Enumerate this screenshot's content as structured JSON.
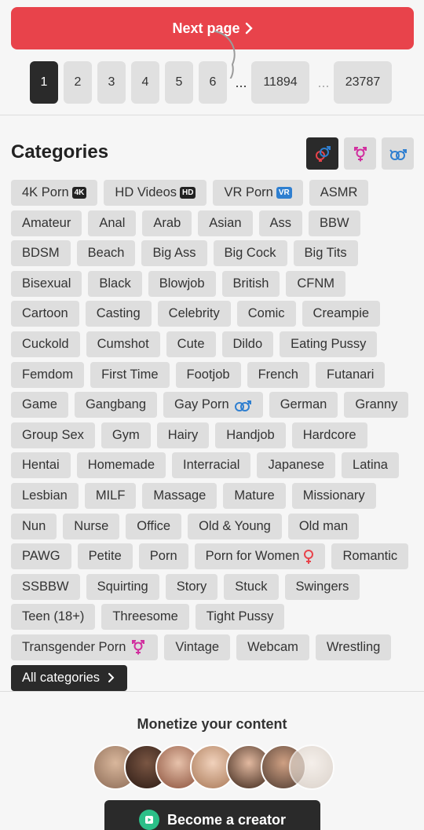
{
  "pager": {
    "next_label": "Next page",
    "pages": [
      "1",
      "2",
      "3",
      "4",
      "5",
      "6"
    ],
    "ellipsis": "...",
    "mid_page": "11894",
    "last_page": "23787",
    "active_page": "1"
  },
  "categories": {
    "title": "Categories",
    "items": [
      {
        "label": "4K Porn",
        "badge": "4K"
      },
      {
        "label": "HD Videos",
        "badge": "HD"
      },
      {
        "label": "VR Porn",
        "badge": "VR"
      },
      {
        "label": "ASMR"
      },
      {
        "label": "Amateur"
      },
      {
        "label": "Anal"
      },
      {
        "label": "Arab"
      },
      {
        "label": "Asian"
      },
      {
        "label": "Ass"
      },
      {
        "label": "BBW"
      },
      {
        "label": "BDSM"
      },
      {
        "label": "Beach"
      },
      {
        "label": "Big Ass"
      },
      {
        "label": "Big Cock"
      },
      {
        "label": "Big Tits"
      },
      {
        "label": "Bisexual"
      },
      {
        "label": "Black"
      },
      {
        "label": "Blowjob"
      },
      {
        "label": "British"
      },
      {
        "label": "CFNM"
      },
      {
        "label": "Cartoon"
      },
      {
        "label": "Casting"
      },
      {
        "label": "Celebrity"
      },
      {
        "label": "Comic"
      },
      {
        "label": "Creampie"
      },
      {
        "label": "Cuckold"
      },
      {
        "label": "Cumshot"
      },
      {
        "label": "Cute"
      },
      {
        "label": "Dildo"
      },
      {
        "label": "Eating Pussy"
      },
      {
        "label": "Femdom"
      },
      {
        "label": "First Time"
      },
      {
        "label": "Footjob"
      },
      {
        "label": "French"
      },
      {
        "label": "Futanari"
      },
      {
        "label": "Game"
      },
      {
        "label": "Gangbang"
      },
      {
        "label": "Gay Porn",
        "icon": "gay-icon"
      },
      {
        "label": "German"
      },
      {
        "label": "Granny"
      },
      {
        "label": "Group Sex"
      },
      {
        "label": "Gym"
      },
      {
        "label": "Hairy"
      },
      {
        "label": "Handjob"
      },
      {
        "label": "Hardcore"
      },
      {
        "label": "Hentai"
      },
      {
        "label": "Homemade"
      },
      {
        "label": "Interracial"
      },
      {
        "label": "Japanese"
      },
      {
        "label": "Latina"
      },
      {
        "label": "Lesbian"
      },
      {
        "label": "MILF"
      },
      {
        "label": "Massage"
      },
      {
        "label": "Mature"
      },
      {
        "label": "Missionary"
      },
      {
        "label": "Nun"
      },
      {
        "label": "Nurse"
      },
      {
        "label": "Office"
      },
      {
        "label": "Old & Young"
      },
      {
        "label": "Old man"
      },
      {
        "label": "PAWG"
      },
      {
        "label": "Petite"
      },
      {
        "label": "Porn"
      },
      {
        "label": "Porn for Women",
        "icon": "female-icon"
      },
      {
        "label": "Romantic"
      },
      {
        "label": "SSBBW"
      },
      {
        "label": "Squirting"
      },
      {
        "label": "Story"
      },
      {
        "label": "Stuck"
      },
      {
        "label": "Swingers"
      },
      {
        "label": "Teen (18+)"
      },
      {
        "label": "Threesome"
      },
      {
        "label": "Tight Pussy"
      },
      {
        "label": "Transgender Porn",
        "icon": "trans-icon"
      },
      {
        "label": "Vintage"
      },
      {
        "label": "Webcam"
      },
      {
        "label": "Wrestling"
      }
    ],
    "all_label": "All categories"
  },
  "monetize": {
    "title": "Monetize your content",
    "button_label": "Become a creator"
  },
  "colors": {
    "accent": "#e8434b",
    "dark": "#2a2a2a",
    "chip": "#dedede",
    "gay_blue": "#2f7fd0",
    "female_red": "#e8434b",
    "trans_pink": "#d12f9f",
    "creator_green": "#2bbf88"
  }
}
